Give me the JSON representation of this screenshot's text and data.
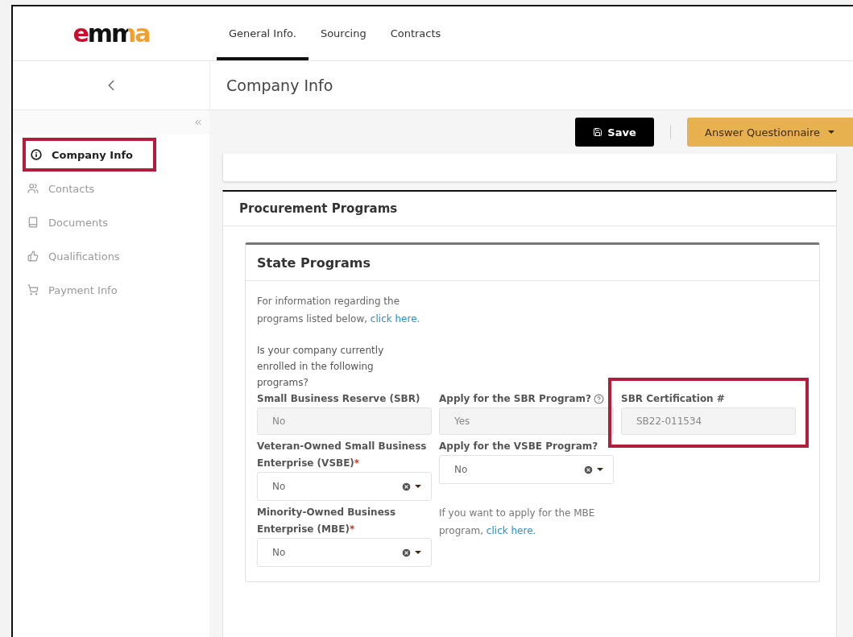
{
  "logo": "emma",
  "tabs": [
    {
      "label": "General Info.",
      "selected": true
    },
    {
      "label": "Sourcing",
      "selected": false
    },
    {
      "label": "Contracts",
      "selected": false
    }
  ],
  "page_title": "Company Info",
  "sidebar": {
    "items": [
      {
        "label": "Company Info",
        "selected": true,
        "highlighted": true
      },
      {
        "label": "Contacts",
        "selected": false,
        "highlighted": false
      },
      {
        "label": "Documents",
        "selected": false,
        "highlighted": false
      },
      {
        "label": "Qualifications",
        "selected": false,
        "highlighted": false
      },
      {
        "label": "Payment Info",
        "selected": false,
        "highlighted": false
      }
    ]
  },
  "toolbar": {
    "save": "Save",
    "questionnaire": "Answer Questionnaire"
  },
  "section": {
    "title": "Procurement Programs",
    "panel": {
      "title": "State Programs",
      "intro": {
        "text": "For information regarding the programs listed below, ",
        "link": "click here."
      },
      "question": "Is your company currently enrolled in the following programs?",
      "rows": [
        [
          {
            "kind": "readonly",
            "label": "Small Business Reserve (SBR)",
            "help": false,
            "value": "No",
            "highlighted": false
          },
          {
            "kind": "readonly",
            "label": "Apply for the SBR Program?",
            "help": true,
            "value": "Yes",
            "highlighted": false
          },
          {
            "kind": "readonly",
            "label": "SBR Certification #",
            "help": false,
            "value": "SB22-011534",
            "highlighted": true
          }
        ],
        [
          {
            "kind": "select",
            "label": "Veteran-Owned Small Business Enterprise (VSBE)",
            "required_mark": "*",
            "help": false,
            "value": "No",
            "highlighted": false
          },
          {
            "kind": "select",
            "label": "Apply for the VSBE Program?",
            "help": false,
            "value": "No",
            "highlighted": false
          }
        ],
        [
          {
            "kind": "select",
            "label": "Minority-Owned Business Enterprise (MBE)",
            "required_mark": "*",
            "help": false,
            "value": "No",
            "highlighted": false
          },
          {
            "kind": "note",
            "text": "If you want to apply for the MBE program, ",
            "link": "click here."
          }
        ]
      ]
    }
  }
}
